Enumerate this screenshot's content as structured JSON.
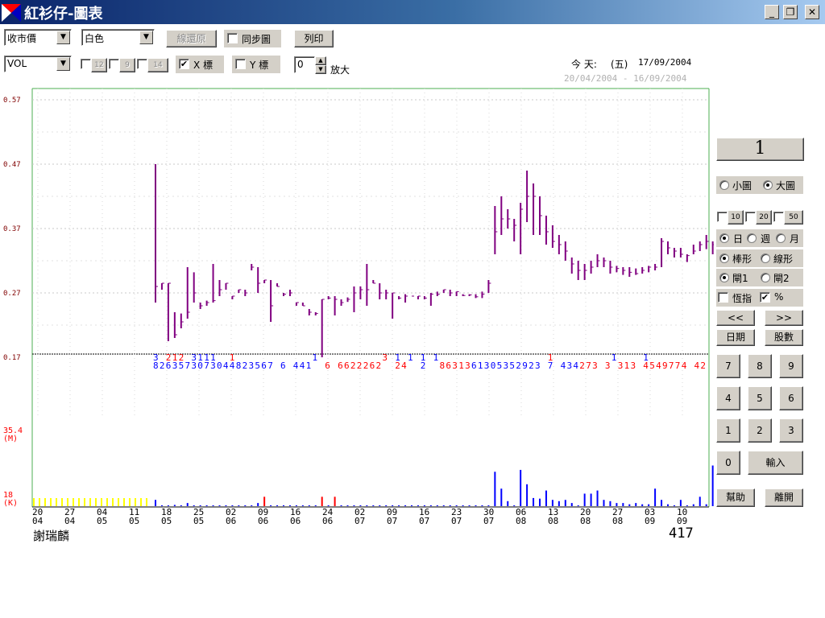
{
  "window": {
    "title": "紅衫仔-圖表",
    "minimize": "_",
    "restore": "❐",
    "close": "✕"
  },
  "toolbar": {
    "price_select": "收市價",
    "color_select": "白色",
    "restore_lines": "線還原",
    "sync_chart": "同步圖",
    "print": "列印",
    "indicator_select": "VOL",
    "ma1": "12",
    "ma2": "9",
    "ma3": "14",
    "x_label": "X 標",
    "x_checked": true,
    "y_label": "Y 標",
    "y_checked": false,
    "zoom_value": "0",
    "zoom_label": "放大"
  },
  "header_info": {
    "today_label": "今 天:",
    "weekday": "(五)",
    "today_date": "17/09/2004",
    "range": "20/04/2004 - 16/09/2004"
  },
  "footer": {
    "stock_name": "謝瑞麟",
    "stock_code": "417"
  },
  "right_panel": {
    "number_display": "1",
    "small_chart": "小圖",
    "big_chart": "大圖",
    "chart_size": "big",
    "ma_10": "10",
    "ma_20": "20",
    "ma_50": "50",
    "period_day": "日",
    "period_week": "週",
    "period_month": "月",
    "period": "day",
    "style_bar": "棒形",
    "style_line": "線形",
    "style": "bar",
    "close1": "閘1",
    "close2": "閘2",
    "close_sel": "1",
    "hsi": "恆指",
    "pct": "%",
    "pct_checked": true,
    "prev": "<<",
    "next": ">>",
    "date_btn": "日期",
    "shares_btn": "股數",
    "keys": [
      "7",
      "8",
      "9",
      "4",
      "5",
      "6",
      "1",
      "2",
      "3",
      "0"
    ],
    "enter": "輸入",
    "help": "幫助",
    "exit": "離開"
  },
  "colors": {
    "price_bar": "#800080",
    "volume_up": "#0000ff",
    "volume_down": "#ff0000",
    "volume_pre": "#ffff00",
    "axis_label": "#800000"
  },
  "chart_data": {
    "type": "bar",
    "price_axis": {
      "ticks": [
        "0.57",
        "0.47",
        "0.37",
        "0.27",
        "0.17"
      ],
      "ylim": [
        0.17,
        0.57
      ]
    },
    "volume_axis": {
      "top": "35.4",
      "top_unit": "(M)",
      "bottom": "18",
      "bottom_unit": "(K)"
    },
    "x_ticks": [
      [
        "20",
        "04"
      ],
      [
        "27",
        "04"
      ],
      [
        "04",
        "05"
      ],
      [
        "11",
        "05"
      ],
      [
        "18",
        "05"
      ],
      [
        "25",
        "05"
      ],
      [
        "02",
        "06"
      ],
      [
        "09",
        "06"
      ],
      [
        "16",
        "06"
      ],
      [
        "24",
        "06"
      ],
      [
        "02",
        "07"
      ],
      [
        "09",
        "07"
      ],
      [
        "16",
        "07"
      ],
      [
        "23",
        "07"
      ],
      [
        "30",
        "07"
      ],
      [
        "06",
        "08"
      ],
      [
        "13",
        "08"
      ],
      [
        "20",
        "08"
      ],
      [
        "27",
        "08"
      ],
      [
        "03",
        "09"
      ],
      [
        "10",
        "09"
      ]
    ],
    "ohlc": [
      [
        0.47,
        0.255,
        0.28
      ],
      [
        0.285,
        0.275,
        0.285
      ],
      [
        0.285,
        0.195,
        0.285
      ],
      [
        0.24,
        0.2,
        0.205
      ],
      [
        0.238,
        0.215,
        0.225
      ],
      [
        0.31,
        0.23,
        0.24
      ],
      [
        0.302,
        0.255,
        0.27
      ],
      [
        0.255,
        0.245,
        0.25
      ],
      [
        0.258,
        0.25,
        0.255
      ],
      [
        0.315,
        0.255,
        0.258
      ],
      [
        0.29,
        0.265,
        0.275
      ],
      [
        0.285,
        0.275,
        0.285
      ],
      [
        0.265,
        0.26,
        0.265
      ],
      [
        0.275,
        0.27,
        0.275
      ],
      [
        0.275,
        0.265,
        0.27
      ],
      [
        0.315,
        0.305,
        0.31
      ],
      [
        0.31,
        0.27,
        0.285
      ],
      [
        0.29,
        0.285,
        0.29
      ],
      [
        0.29,
        0.225,
        0.25
      ],
      [
        0.285,
        0.28,
        0.28
      ],
      [
        0.27,
        0.265,
        0.268
      ],
      [
        0.275,
        0.265,
        0.27
      ],
      [
        0.255,
        0.25,
        0.255
      ],
      [
        0.255,
        0.25,
        0.25
      ],
      [
        0.245,
        0.235,
        0.24
      ],
      [
        0.24,
        0.235,
        0.238
      ],
      [
        0.26,
        0.17,
        0.26
      ],
      [
        0.265,
        0.26,
        0.262
      ],
      [
        0.265,
        0.235,
        0.26
      ],
      [
        0.26,
        0.25,
        0.255
      ],
      [
        0.263,
        0.256,
        0.26
      ],
      [
        0.28,
        0.24,
        0.27
      ],
      [
        0.28,
        0.26,
        0.275
      ],
      [
        0.315,
        0.25,
        0.275
      ],
      [
        0.29,
        0.285,
        0.285
      ],
      [
        0.285,
        0.26,
        0.27
      ],
      [
        0.275,
        0.26,
        0.27
      ],
      [
        0.27,
        0.23,
        0.27
      ],
      [
        0.265,
        0.26,
        0.262
      ],
      [
        0.268,
        0.255,
        0.265
      ],
      [
        0.265,
        0.265,
        0.265
      ],
      [
        0.265,
        0.26,
        0.265
      ],
      [
        0.265,
        0.26,
        0.262
      ],
      [
        0.27,
        0.25,
        0.268
      ],
      [
        0.272,
        0.265,
        0.268
      ],
      [
        0.275,
        0.27,
        0.275
      ],
      [
        0.275,
        0.265,
        0.27
      ],
      [
        0.272,
        0.265,
        0.272
      ],
      [
        0.268,
        0.265,
        0.266
      ],
      [
        0.268,
        0.265,
        0.267
      ],
      [
        0.268,
        0.262,
        0.264
      ],
      [
        0.272,
        0.262,
        0.268
      ],
      [
        0.29,
        0.27,
        0.285
      ],
      [
        0.405,
        0.33,
        0.365
      ],
      [
        0.42,
        0.36,
        0.385
      ],
      [
        0.4,
        0.37,
        0.385
      ],
      [
        0.385,
        0.35,
        0.375
      ],
      [
        0.41,
        0.33,
        0.4
      ],
      [
        0.46,
        0.38,
        0.42
      ],
      [
        0.44,
        0.36,
        0.42
      ],
      [
        0.42,
        0.36,
        0.39
      ],
      [
        0.39,
        0.345,
        0.365
      ],
      [
        0.375,
        0.34,
        0.35
      ],
      [
        0.36,
        0.33,
        0.345
      ],
      [
        0.35,
        0.32,
        0.335
      ],
      [
        0.325,
        0.3,
        0.315
      ],
      [
        0.32,
        0.29,
        0.305
      ],
      [
        0.315,
        0.29,
        0.305
      ],
      [
        0.32,
        0.3,
        0.31
      ],
      [
        0.33,
        0.31,
        0.32
      ],
      [
        0.325,
        0.31,
        0.32
      ],
      [
        0.32,
        0.3,
        0.31
      ],
      [
        0.312,
        0.302,
        0.308
      ],
      [
        0.31,
        0.298,
        0.305
      ],
      [
        0.31,
        0.295,
        0.302
      ],
      [
        0.308,
        0.298,
        0.3
      ],
      [
        0.31,
        0.3,
        0.305
      ],
      [
        0.312,
        0.302,
        0.31
      ],
      [
        0.315,
        0.305,
        0.31
      ],
      [
        0.355,
        0.31,
        0.35
      ],
      [
        0.35,
        0.33,
        0.34
      ],
      [
        0.34,
        0.325,
        0.335
      ],
      [
        0.34,
        0.325,
        0.33
      ],
      [
        0.33,
        0.318,
        0.328
      ],
      [
        0.345,
        0.33,
        0.335
      ],
      [
        0.35,
        0.335,
        0.345
      ],
      [
        0.36,
        0.338,
        0.35
      ],
      [
        0.35,
        0.33,
        0.345
      ],
      [
        0.34,
        0.335,
        0.338
      ],
      [
        0.41,
        0.34,
        0.4
      ],
      [
        0.4,
        0.375,
        0.39
      ],
      [
        0.4,
        0.38,
        0.39
      ],
      [
        0.42,
        0.39,
        0.4
      ],
      [
        0.455,
        0.405,
        0.44
      ],
      [
        0.465,
        0.43,
        0.46
      ],
      [
        0.52,
        0.46,
        0.51
      ],
      [
        0.58,
        0.5,
        0.54
      ],
      [
        0.56,
        0.51,
        0.52
      ],
      [
        0.54,
        0.49,
        0.51
      ],
      [
        0.55,
        0.5,
        0.53
      ]
    ],
    "volume_pre_bars": 21,
    "volume": [
      [
        1.0,
        "b"
      ],
      [
        0.0,
        "b"
      ],
      [
        0.0,
        "b"
      ],
      [
        0.2,
        "b"
      ],
      [
        0.0,
        "b"
      ],
      [
        0.5,
        "b"
      ],
      [
        0.0,
        "b"
      ],
      [
        0.0,
        "b"
      ],
      [
        0.0,
        "b"
      ],
      [
        0.0,
        "b"
      ],
      [
        0.0,
        "b"
      ],
      [
        0.0,
        "b"
      ],
      [
        0.0,
        "b"
      ],
      [
        0.0,
        "b"
      ],
      [
        0.0,
        "b"
      ],
      [
        0.0,
        "b"
      ],
      [
        0.5,
        "b"
      ],
      [
        1.5,
        "r"
      ],
      [
        0.0,
        "b"
      ],
      [
        0.0,
        "b"
      ],
      [
        0.0,
        "b"
      ],
      [
        0.0,
        "b"
      ],
      [
        0.0,
        "b"
      ],
      [
        0.0,
        "b"
      ],
      [
        0.0,
        "b"
      ],
      [
        0.0,
        "b"
      ],
      [
        1.5,
        "r"
      ],
      [
        0.0,
        "b"
      ],
      [
        1.5,
        "r"
      ],
      [
        0.0,
        "b"
      ],
      [
        0.0,
        "b"
      ],
      [
        0.0,
        "b"
      ],
      [
        0.0,
        "b"
      ],
      [
        0.0,
        "b"
      ],
      [
        0.0,
        "b"
      ],
      [
        0.0,
        "b"
      ],
      [
        0.0,
        "b"
      ],
      [
        0.0,
        "b"
      ],
      [
        0.0,
        "b"
      ],
      [
        0.0,
        "b"
      ],
      [
        0.0,
        "b"
      ],
      [
        0.0,
        "b"
      ],
      [
        0.0,
        "b"
      ],
      [
        0.0,
        "b"
      ],
      [
        0.0,
        "b"
      ],
      [
        0.0,
        "b"
      ],
      [
        0.0,
        "b"
      ],
      [
        0.0,
        "b"
      ],
      [
        0.0,
        "b"
      ],
      [
        0.0,
        "b"
      ],
      [
        0.0,
        "b"
      ],
      [
        0.0,
        "b"
      ],
      [
        0.0,
        "b"
      ],
      [
        5.5,
        "b"
      ],
      [
        2.8,
        "b"
      ],
      [
        0.8,
        "b"
      ],
      [
        0.0,
        "b"
      ],
      [
        5.8,
        "b"
      ],
      [
        3.5,
        "b"
      ],
      [
        1.3,
        "b"
      ],
      [
        1.2,
        "b"
      ],
      [
        2.5,
        "b"
      ],
      [
        1.0,
        "b"
      ],
      [
        0.8,
        "b"
      ],
      [
        1.0,
        "b"
      ],
      [
        0.5,
        "b"
      ],
      [
        0.0,
        "b"
      ],
      [
        2.0,
        "b"
      ],
      [
        2.0,
        "b"
      ],
      [
        2.5,
        "b"
      ],
      [
        1.0,
        "b"
      ],
      [
        0.8,
        "b"
      ],
      [
        0.5,
        "b"
      ],
      [
        0.5,
        "b"
      ],
      [
        0.3,
        "b"
      ],
      [
        0.5,
        "b"
      ],
      [
        0.3,
        "b"
      ],
      [
        0.3,
        "b"
      ],
      [
        2.8,
        "b"
      ],
      [
        1.0,
        "b"
      ],
      [
        0.3,
        "b"
      ],
      [
        0.0,
        "b"
      ],
      [
        1.0,
        "b"
      ],
      [
        0.0,
        "b"
      ],
      [
        0.3,
        "b"
      ],
      [
        1.5,
        "b"
      ],
      [
        0.3,
        "b"
      ],
      [
        6.5,
        "b"
      ],
      [
        3.3,
        "b"
      ],
      [
        0.0,
        "b"
      ],
      [
        8.5,
        "b"
      ],
      [
        5.5,
        "b"
      ],
      [
        12.0,
        "b"
      ],
      [
        11.0,
        "b"
      ],
      [
        5.5,
        "b"
      ],
      [
        3.0,
        "b"
      ]
    ],
    "volume_ylim": [
      0,
      13
    ],
    "digit_rows": [
      {
        "text": "3 212 3111  1            1          3 1 1 1 1                 1         1    1   ",
        "colors": "bbrrrrbbbbrrrbbbbbbbbbbbbbrrrrrrrrrrrrbbbbbbbbbbbbbbbbbbbbbbrrrrrrrrrrbbbbbbbbbbbrr"
      },
      {
        "text": "8263573073044823567 6 441  6 6622262  24  2  8631361305352923 7 434273 3 313 4549774 42",
        "colors": "bbbbbbbbbbbbbbbbbbbbbbbbbbbrrrrrrrrrrrrrrbbbrrrrrrbbbbbbbbbbbbbbbbbrrrrrrrrrrrrrrrrrrrrrrrr"
      }
    ]
  }
}
